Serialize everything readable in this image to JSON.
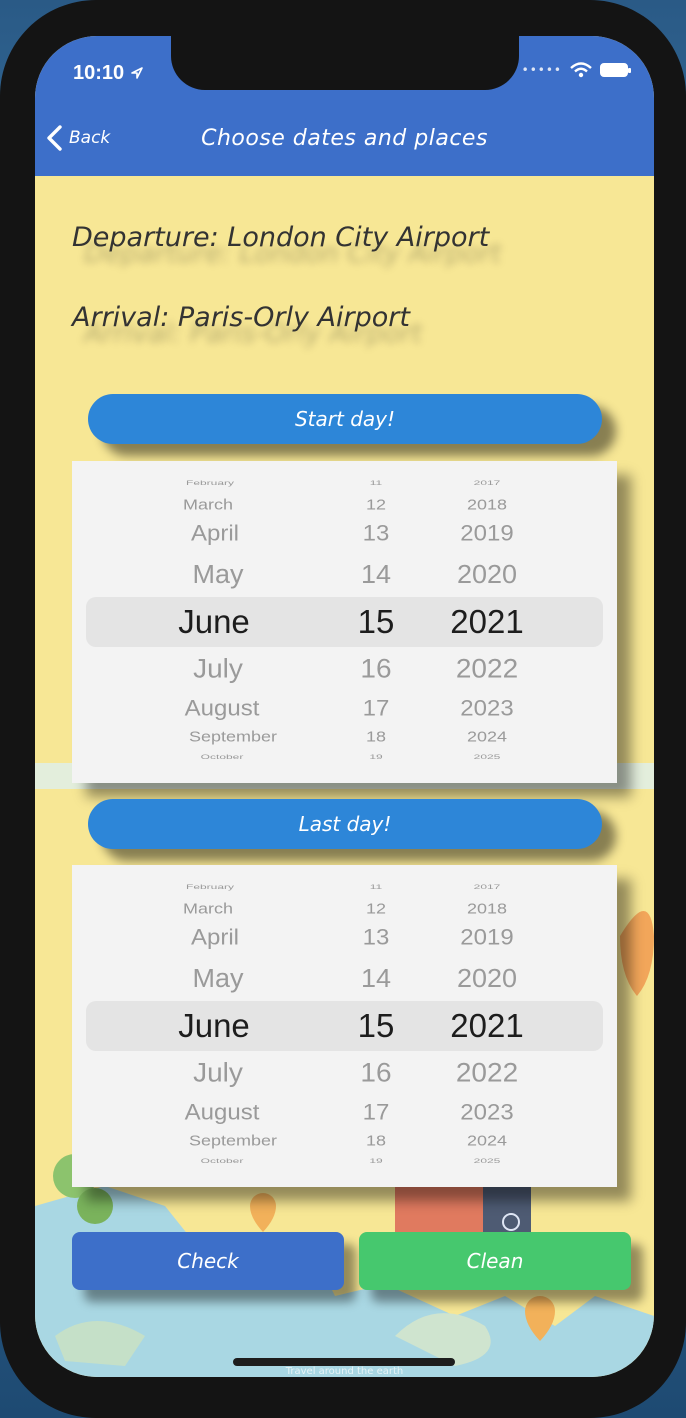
{
  "status": {
    "time": "10:10"
  },
  "nav": {
    "back_label": "Back",
    "title": "Choose dates and places"
  },
  "trip": {
    "departure": "Departure: London City Airport",
    "arrival": "Arrival: Paris-Orly Airport"
  },
  "start_button": "Start day!",
  "last_button": "Last day!",
  "pickers": [
    {
      "rows": [
        {
          "month": "February",
          "day": "11",
          "year": "2017"
        },
        {
          "month": "March",
          "day": "12",
          "year": "2018"
        },
        {
          "month": "April",
          "day": "13",
          "year": "2019"
        },
        {
          "month": "May",
          "day": "14",
          "year": "2020"
        },
        {
          "month": "June",
          "day": "15",
          "year": "2021"
        },
        {
          "month": "July",
          "day": "16",
          "year": "2022"
        },
        {
          "month": "August",
          "day": "17",
          "year": "2023"
        },
        {
          "month": "September",
          "day": "18",
          "year": "2024"
        },
        {
          "month": "October",
          "day": "19",
          "year": "2025"
        }
      ],
      "selected": {
        "month": "June",
        "day": "15",
        "year": "2021"
      }
    },
    {
      "rows": [
        {
          "month": "February",
          "day": "11",
          "year": "2017"
        },
        {
          "month": "March",
          "day": "12",
          "year": "2018"
        },
        {
          "month": "April",
          "day": "13",
          "year": "2019"
        },
        {
          "month": "May",
          "day": "14",
          "year": "2020"
        },
        {
          "month": "June",
          "day": "15",
          "year": "2021"
        },
        {
          "month": "July",
          "day": "16",
          "year": "2022"
        },
        {
          "month": "August",
          "day": "17",
          "year": "2023"
        },
        {
          "month": "September",
          "day": "18",
          "year": "2024"
        },
        {
          "month": "October",
          "day": "19",
          "year": "2025"
        }
      ],
      "selected": {
        "month": "June",
        "day": "15",
        "year": "2021"
      }
    }
  ],
  "actions": {
    "check": "Check",
    "clean": "Clean"
  },
  "footer": {
    "caption": "Travel around the earth"
  },
  "colors": {
    "navbar": "#3d6fc9",
    "background": "#f7e795",
    "pill_button": "#2d86d8",
    "check_button": "#3d6fc9",
    "clean_button": "#46c86e"
  },
  "icons": [
    "back-chevron-icon",
    "navigation-arrow-icon",
    "wifi-icon",
    "battery-icon",
    "signal-dots-icon"
  ]
}
